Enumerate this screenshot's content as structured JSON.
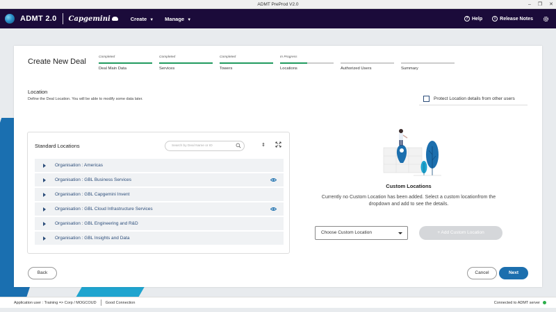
{
  "window": {
    "title": "ADMT PreProd V2.0",
    "minimize": "–",
    "restore": "❐",
    "close": "✕"
  },
  "header": {
    "app_name": "ADMT 2.0",
    "brand": "Capgemini",
    "nav": [
      {
        "label": "Create"
      },
      {
        "label": "Manage"
      }
    ],
    "help_label": "Help",
    "release_notes_label": "Release Notes"
  },
  "card": {
    "title": "Create New Deal",
    "steps": [
      {
        "status": "Completed",
        "label": "Deal Main Data",
        "progress": 1.0
      },
      {
        "status": "Completed",
        "label": "Services",
        "progress": 1.0
      },
      {
        "status": "Completed",
        "label": "Towers",
        "progress": 1.0
      },
      {
        "status": "In Progress",
        "label": "Locations",
        "progress": 0.5
      },
      {
        "status": "",
        "label": "Authorized Users",
        "progress": 0
      },
      {
        "status": "",
        "label": "Summary",
        "progress": 0
      }
    ],
    "location_title": "Location",
    "location_desc": "Define the Deal Location. You will be able to modify some data later.",
    "protect_label": "Protect Location details from other users"
  },
  "standard_locations": {
    "title": "Standard Locations",
    "search_placeholder": "Search by Deal Name or ID",
    "rows": [
      {
        "label": "Organisation : Americas",
        "visible": false
      },
      {
        "label": "Organisation : GBL Business Services",
        "visible": true
      },
      {
        "label": "Organisation : GBL Capgemini Invent",
        "visible": false
      },
      {
        "label": "Organisation : GBL Cloud Infrastructure Services",
        "visible": true
      },
      {
        "label": "Organisation : GBL Engineering and R&D",
        "visible": false
      },
      {
        "label": "Organisation : GBL Insights and Data",
        "visible": false
      }
    ]
  },
  "custom_locations": {
    "title": "Custom Locations",
    "message": "Currently no Custom Location has been added. Select a custom locationfrom the dropdown and add to see the details.",
    "dropdown_value": "Choose Custom Location",
    "add_button": "+ Add Custom Location"
  },
  "footer": {
    "back": "Back",
    "cancel": "Cancel",
    "next": "Next"
  },
  "status": {
    "user": "Application user : Training => Corp / MOGCOUD",
    "connection": "Good Connection",
    "server": "Connected to ADMT server"
  },
  "colors": {
    "header_bg": "#1b0b3a",
    "completed": "#1f9a5e",
    "primary": "#1c6fae",
    "link": "#2c4d7a"
  }
}
